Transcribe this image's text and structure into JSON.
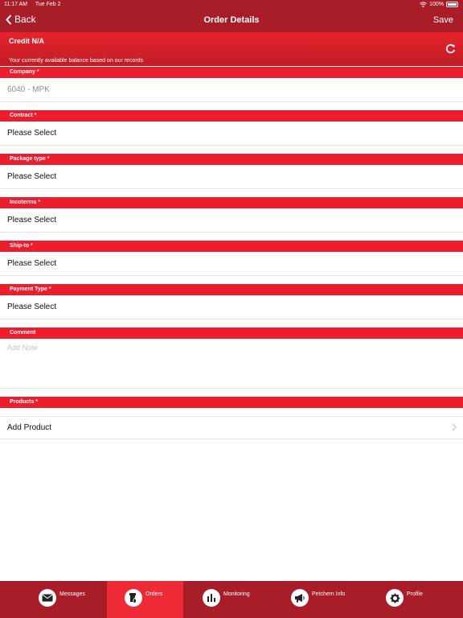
{
  "status_bar": {
    "time": "11:17 AM",
    "date": "Tue Feb 2",
    "battery": "100%"
  },
  "nav": {
    "back_label": "Back",
    "title": "Order Details",
    "save_label": "Save"
  },
  "credit": {
    "label": "Credit  N/A",
    "note": "Your currently available balance based on our records"
  },
  "form": {
    "company_header": "Company *",
    "company_value": "6040 - MPK",
    "contract_header": "Contract *",
    "contract_value": "Please Select",
    "package_header": "Package type *",
    "package_value": "Please Select",
    "incoterms_header": "Incoterms *",
    "incoterms_value": "Please Select",
    "shipto_header": "Ship-to *",
    "shipto_value": "Please Select",
    "payment_header": "Payment Type *",
    "payment_value": "Please Select",
    "comment_header": "Comment",
    "comment_placeholder": "Add Note",
    "products_header": "Products *",
    "add_product_label": "Add Product"
  },
  "tabs": [
    {
      "label": "Messages",
      "icon": "envelope-icon",
      "active": false
    },
    {
      "label": "Orders",
      "icon": "barrel-icon",
      "active": true
    },
    {
      "label": "Monitoring",
      "icon": "bar-chart-icon",
      "active": false
    },
    {
      "label": "Petchem Info",
      "icon": "megaphone-icon",
      "active": false
    },
    {
      "label": "Profile",
      "icon": "gear-icon",
      "active": false
    }
  ],
  "colors": {
    "nav_bg": "#a91d28",
    "section_header": "#ee1d2e",
    "active_tab": "#ee2a36"
  }
}
